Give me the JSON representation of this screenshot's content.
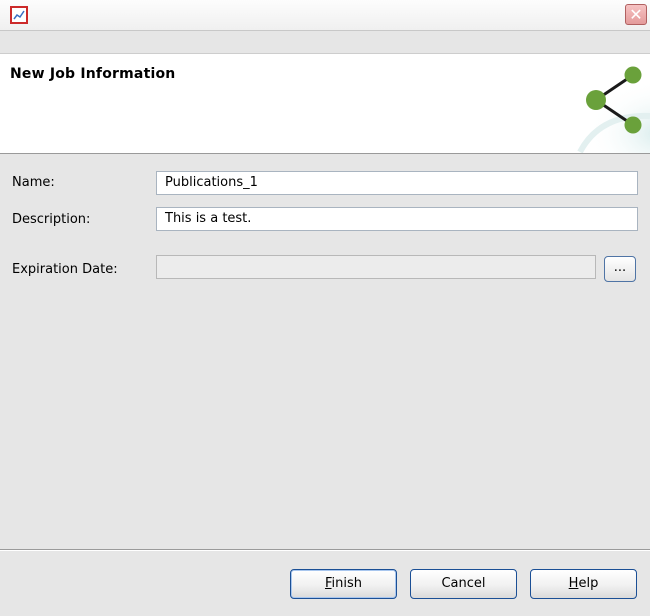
{
  "window": {
    "close_glyph": "✕"
  },
  "banner": {
    "title": "New Job Information"
  },
  "form": {
    "name_label": "Name:",
    "name_value": "Publications_1",
    "description_label": "Description:",
    "description_value": "This is a test.",
    "expiration_label": "Expiration Date:",
    "expiration_value": "",
    "browse_label": "..."
  },
  "buttons": {
    "finish": {
      "mnemonic": "F",
      "rest": "inish"
    },
    "cancel": "Cancel",
    "help": {
      "mnemonic": "H",
      "rest": "elp"
    }
  },
  "colors": {
    "graphic_node": "#6aa13b",
    "close_red": "#d88a8a",
    "app_icon_red": "#cc2a2a"
  },
  "icons": {
    "app": "chart-icon",
    "close": "close-icon",
    "banner": "share-network-icon"
  }
}
